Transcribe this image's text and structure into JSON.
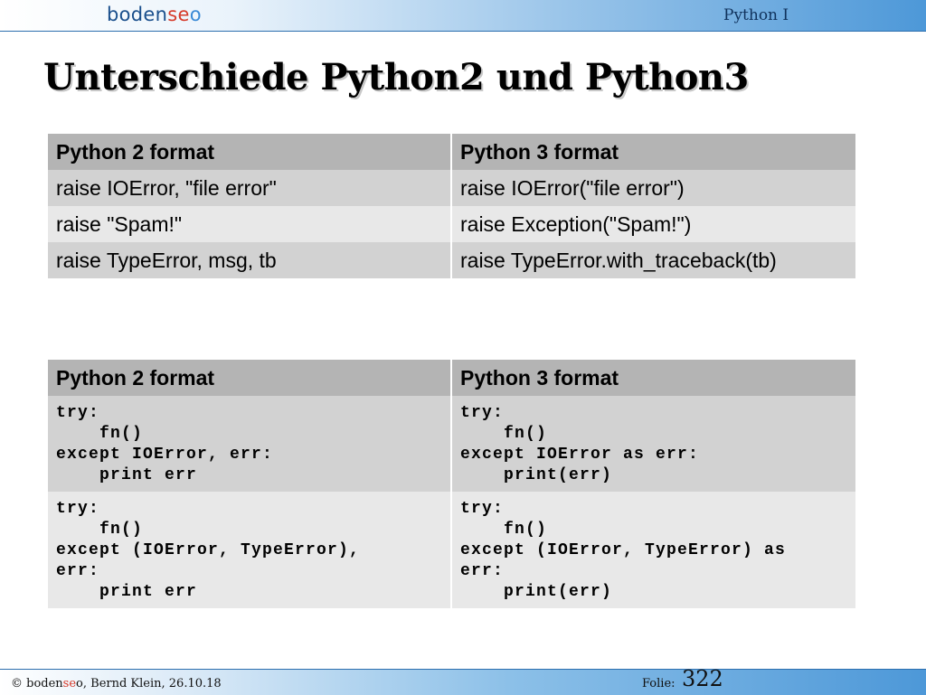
{
  "header": {
    "logo_part1": "boden",
    "logo_part2": "se",
    "logo_part3": "o",
    "course": "Python I"
  },
  "title": "Unterschiede Python2 und Python3",
  "table1": {
    "headers": [
      "Python 2 format",
      "Python 3 format"
    ],
    "rows": [
      [
        "raise IOError, \"file error\"",
        "raise IOError(\"file error\")"
      ],
      [
        "raise \"Spam!\"",
        "raise Exception(\"Spam!\")"
      ],
      [
        "raise TypeError, msg, tb",
        "raise TypeError.with_traceback(tb)"
      ]
    ]
  },
  "table2": {
    "headers": [
      "Python 2 format",
      "Python 3 format"
    ],
    "rows": [
      [
        "try:\n    fn()\nexcept IOError, err:\n    print err",
        "try:\n    fn()\nexcept IOError as err:\n    print(err)"
      ],
      [
        "try:\n    fn()\nexcept (IOError, TypeError),\nerr:\n    print err",
        "try:\n    fn()\nexcept (IOError, TypeError) as\nerr:\n    print(err)"
      ]
    ]
  },
  "footer": {
    "copyright_prefix": "© boden",
    "copyright_accent": "se",
    "copyright_suffix": "o, Bernd Klein, 26.10.18",
    "slide_label": "Folie:",
    "slide_number": "322"
  },
  "colors": {
    "header_blue": "#4d98d8",
    "logo_dark": "#1a4f8c",
    "logo_accent": "#d63a2a",
    "table_header": "#b4b4b4",
    "row_dark": "#d2d2d2",
    "row_light": "#e8e8e8"
  }
}
